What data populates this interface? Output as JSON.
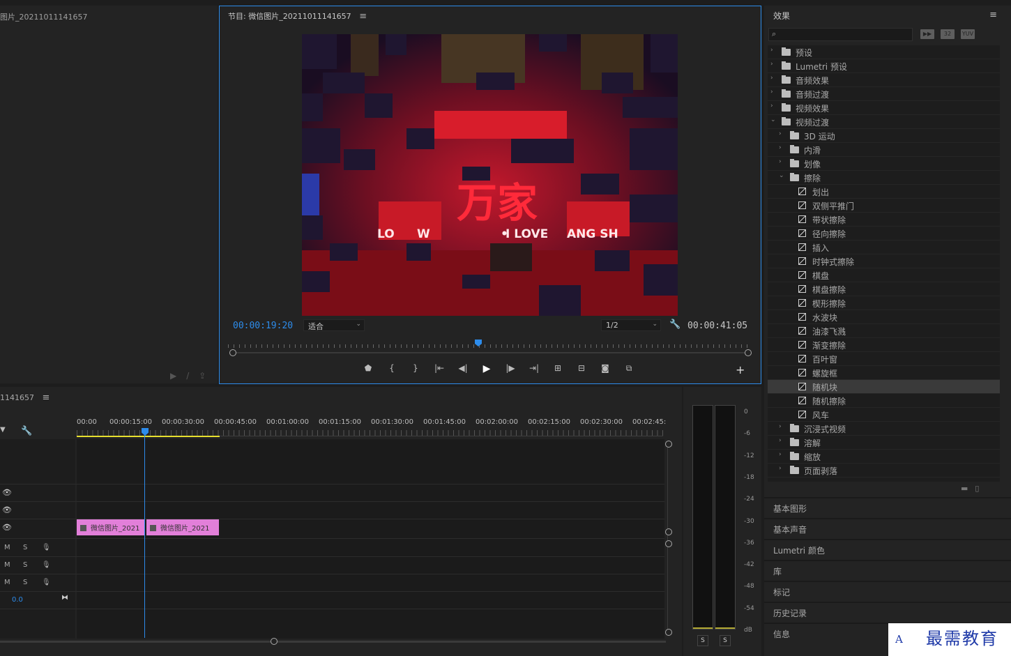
{
  "source": {
    "title": "图片_20211011141657"
  },
  "program": {
    "title": "节目: 微信图片_20211011141657",
    "menu": "≡",
    "timecode_current": "00:00:19:20",
    "timecode_duration": "00:00:41:05",
    "zoom_select": "适合",
    "resolution_select": "1/2",
    "playback_position": 0.48,
    "video_text": [
      "万家",
      "I LOVE",
      "ANG SH",
      "LO",
      "W"
    ]
  },
  "effects": {
    "title": "效果",
    "menu": "≡",
    "search_placeholder": "",
    "search_icon": "⌕",
    "filter_buttons": [
      "加速",
      "32",
      "YUV"
    ],
    "tree": [
      {
        "label": "预设",
        "level": 0,
        "type": "special-folder",
        "expanded": false
      },
      {
        "label": "Lumetri 预设",
        "level": 0,
        "type": "special-folder",
        "expanded": false
      },
      {
        "label": "音频效果",
        "level": 0,
        "type": "folder",
        "expanded": false
      },
      {
        "label": "音频过渡",
        "level": 0,
        "type": "folder",
        "expanded": false
      },
      {
        "label": "视频效果",
        "level": 0,
        "type": "folder",
        "expanded": false
      },
      {
        "label": "视频过渡",
        "level": 0,
        "type": "folder",
        "expanded": true
      },
      {
        "label": "3D 运动",
        "level": 1,
        "type": "folder",
        "expanded": false
      },
      {
        "label": "内滑",
        "level": 1,
        "type": "folder",
        "expanded": false
      },
      {
        "label": "划像",
        "level": 1,
        "type": "folder",
        "expanded": false
      },
      {
        "label": "擦除",
        "level": 1,
        "type": "folder",
        "expanded": true
      },
      {
        "label": "划出",
        "level": 2,
        "type": "effect"
      },
      {
        "label": "双侧平推门",
        "level": 2,
        "type": "effect"
      },
      {
        "label": "带状擦除",
        "level": 2,
        "type": "effect"
      },
      {
        "label": "径向擦除",
        "level": 2,
        "type": "effect"
      },
      {
        "label": "插入",
        "level": 2,
        "type": "effect"
      },
      {
        "label": "时钟式擦除",
        "level": 2,
        "type": "effect"
      },
      {
        "label": "棋盘",
        "level": 2,
        "type": "effect"
      },
      {
        "label": "棋盘擦除",
        "level": 2,
        "type": "effect"
      },
      {
        "label": "楔形擦除",
        "level": 2,
        "type": "effect"
      },
      {
        "label": "水波块",
        "level": 2,
        "type": "effect"
      },
      {
        "label": "油漆飞溅",
        "level": 2,
        "type": "effect"
      },
      {
        "label": "渐变擦除",
        "level": 2,
        "type": "effect"
      },
      {
        "label": "百叶窗",
        "level": 2,
        "type": "effect"
      },
      {
        "label": "螺旋框",
        "level": 2,
        "type": "effect"
      },
      {
        "label": "随机块",
        "level": 2,
        "type": "effect",
        "selected": true
      },
      {
        "label": "随机擦除",
        "level": 2,
        "type": "effect"
      },
      {
        "label": "风车",
        "level": 2,
        "type": "effect"
      },
      {
        "label": "沉浸式视频",
        "level": 1,
        "type": "folder",
        "expanded": false
      },
      {
        "label": "溶解",
        "level": 1,
        "type": "folder",
        "expanded": false
      },
      {
        "label": "缩放",
        "level": 1,
        "type": "folder",
        "expanded": false
      },
      {
        "label": "页面剥落",
        "level": 1,
        "type": "folder",
        "expanded": false
      }
    ]
  },
  "side_panels": [
    "基本图形",
    "基本声音",
    "Lumetri 颜色",
    "库",
    "标记",
    "历史记录",
    "信息"
  ],
  "timeline": {
    "title": "1141657",
    "menu": "≡",
    "ruler_labels": [
      "00:00",
      "00:00:15:00",
      "00:00:30:00",
      "00:00:45:00",
      "00:01:00:00",
      "00:01:15:00",
      "00:01:30:00",
      "00:01:45:00",
      "00:02:00:00",
      "00:02:15:00",
      "00:02:30:00",
      "00:02:45:"
    ],
    "audio_mute": "M",
    "audio_solo": "S",
    "volume": "0.0",
    "clips": [
      {
        "label": "微信图片_2021"
      },
      {
        "label": "微信图片_2021"
      }
    ]
  },
  "meter": {
    "db_labels": [
      "0",
      "-6",
      "-12",
      "-18",
      "-24",
      "-30",
      "-36",
      "-42",
      "-48",
      "-54",
      "dB"
    ],
    "solo_left": "S",
    "solo_right": "S"
  },
  "watermark": {
    "text": "最需教育",
    "input_indicator": "A"
  },
  "colors": {
    "accent": "#2d8ceb",
    "clip": "#e27fd9",
    "work_area": "#e8e02e"
  }
}
